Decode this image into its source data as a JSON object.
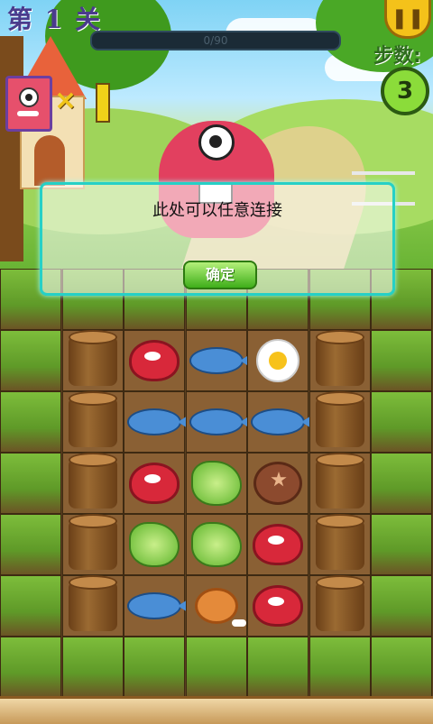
{
  "header": {
    "level_title": "第 1 关",
    "progress_text": "0/90",
    "steps_label": "步数:",
    "steps_value": "3",
    "target_x": "×",
    "target_count": "1"
  },
  "dialog": {
    "message": "此处可以任意连接",
    "confirm_label": "确定"
  },
  "board": {
    "rows": 7,
    "cols": 7,
    "grid": [
      [
        "grass",
        "grass",
        "grass",
        "grass",
        "grass",
        "grass",
        "grass"
      ],
      [
        "grass",
        "stump",
        "meat",
        "fish",
        "egg",
        "stump",
        "grass"
      ],
      [
        "grass",
        "stump",
        "fish",
        "fish",
        "fish",
        "stump",
        "grass"
      ],
      [
        "grass",
        "stump",
        "meat",
        "lettuce",
        "mushroom",
        "stump",
        "grass"
      ],
      [
        "grass",
        "stump",
        "lettuce",
        "lettuce",
        "meat",
        "stump",
        "grass"
      ],
      [
        "grass",
        "stump",
        "fish",
        "drumstick",
        "meat",
        "stump",
        "grass"
      ],
      [
        "grass",
        "grass",
        "grass",
        "grass",
        "grass",
        "grass",
        "grass"
      ]
    ]
  }
}
